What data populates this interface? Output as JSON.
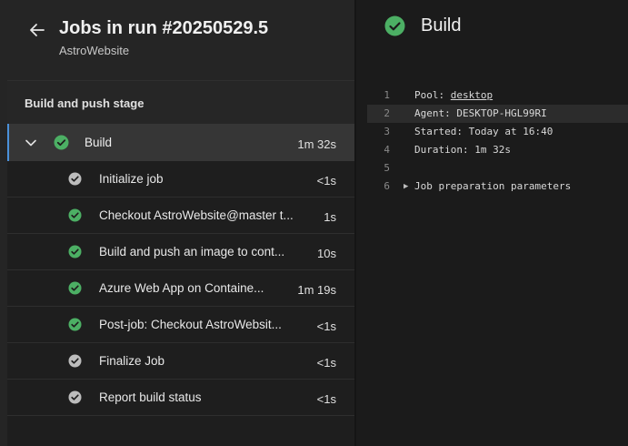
{
  "header": {
    "title": "Jobs in run #20250529.5",
    "subtitle": "AstroWebsite"
  },
  "stage": {
    "label": "Build and push stage"
  },
  "job": {
    "name": "Build",
    "duration": "1m 32s",
    "status": "succeeded"
  },
  "steps": [
    {
      "label": "Initialize job",
      "duration": "<1s",
      "status": "completed"
    },
    {
      "label": "Checkout AstroWebsite@master t...",
      "duration": "1s",
      "status": "succeeded"
    },
    {
      "label": "Build and push an image to cont...",
      "duration": "10s",
      "status": "succeeded"
    },
    {
      "label": "Azure Web App on Containe...",
      "duration": "1m 19s",
      "status": "succeeded"
    },
    {
      "label": "Post-job: Checkout AstroWebsit...",
      "duration": "<1s",
      "status": "succeeded"
    },
    {
      "label": "Finalize Job",
      "duration": "<1s",
      "status": "completed"
    },
    {
      "label": "Report build status",
      "duration": "<1s",
      "status": "completed"
    }
  ],
  "details": {
    "title": "Build",
    "log": [
      {
        "n": "1",
        "prefix": "Pool: ",
        "link": "desktop"
      },
      {
        "n": "2",
        "text": "Agent: DESKTOP-HGL99RI"
      },
      {
        "n": "3",
        "text": "Started: Today at 16:40"
      },
      {
        "n": "4",
        "text": "Duration: 1m 32s"
      },
      {
        "n": "5",
        "text": ""
      },
      {
        "n": "6",
        "text": "Job preparation parameters"
      }
    ]
  },
  "colors": {
    "success": "#4caf64",
    "completed": "#bcbcbc",
    "accent": "#4a90d9"
  }
}
